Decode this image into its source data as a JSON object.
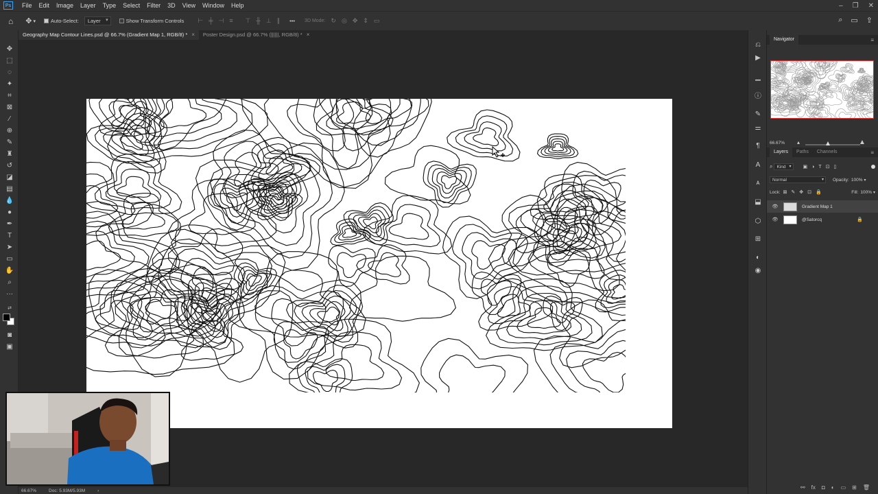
{
  "app": {
    "logo": "Ps"
  },
  "menu": [
    "File",
    "Edit",
    "Image",
    "Layer",
    "Type",
    "Select",
    "Filter",
    "3D",
    "View",
    "Window",
    "Help"
  ],
  "window_controls": {
    "minimize": "–",
    "restore": "❐",
    "close": "✕"
  },
  "options_bar": {
    "auto_select_label": "Auto-Select:",
    "auto_select_checked": true,
    "layer_dropdown": "Layer",
    "show_transform_label": "Show Transform Controls",
    "more": "•••",
    "mode_3d": "3D Mode:"
  },
  "tabs": [
    {
      "label": "Geography Map Contour Lines.psd @ 66.7% (Gradient Map 1, RGB/8) *",
      "active": true
    },
    {
      "label": "Poster Design.psd @ 66.7% (||||||, RGB/8) *",
      "active": false
    }
  ],
  "status": {
    "zoom": "66.67%",
    "doc": "Doc: 5.93M/5.93M",
    "arrow": "›"
  },
  "navigator": {
    "title": "Navigator",
    "zoom": "66.67%",
    "slider_fraction": 0.55
  },
  "layers_panel": {
    "tabs": [
      "Layers",
      "Paths",
      "Channels"
    ],
    "active_tab": "Layers",
    "filter_kind": "Kind",
    "blend_mode": "Normal",
    "opacity_label": "Opacity:",
    "opacity": "100%",
    "lock_label": "Lock:",
    "fill_label": "Fill:",
    "fill": "100%",
    "layers": [
      {
        "name": "Gradient Map 1",
        "visible": true,
        "selected": true,
        "locked": false
      },
      {
        "name": "@Satorcq",
        "visible": true,
        "selected": false,
        "locked": true
      }
    ]
  },
  "colors": {
    "accent": "#31a8ff",
    "ui_bg": "#323232",
    "workspace": "#282828",
    "nav_frame": "#e03030"
  }
}
